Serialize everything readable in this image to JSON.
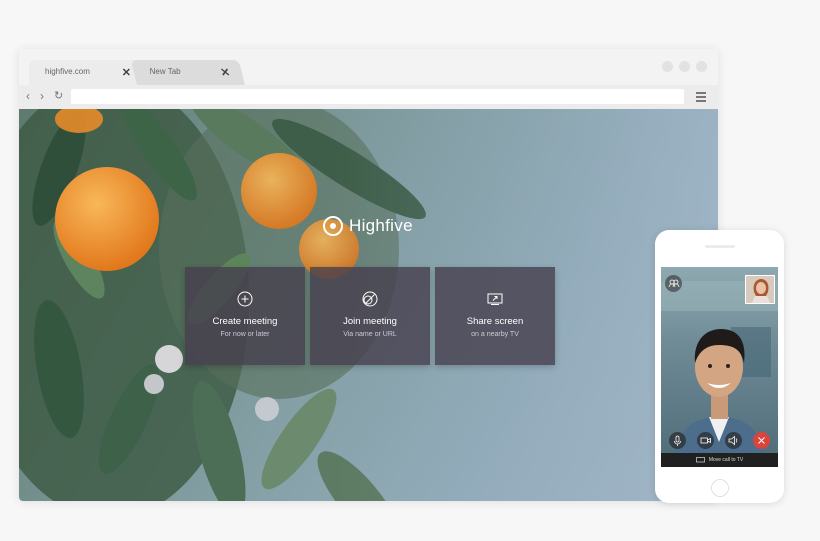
{
  "browser": {
    "tabs": [
      {
        "label": "highfive.com",
        "close": "✕"
      },
      {
        "label": "New Tab",
        "close": "✕"
      }
    ],
    "nav": {
      "back": "‹",
      "forward": "›",
      "reload": "↻"
    }
  },
  "app": {
    "logo_text": "Highfive",
    "cards": [
      {
        "title": "Create meeting",
        "subtitle": "For now or later",
        "icon": "plus-circle-icon"
      },
      {
        "title": "Join meeting",
        "subtitle": "Via name or URL",
        "icon": "join-circle-icon"
      },
      {
        "title": "Share screen",
        "subtitle": "on a nearby TV",
        "icon": "screen-share-icon"
      }
    ]
  },
  "phone": {
    "tv_bar_label": "Move call to TV",
    "controls": [
      "mic-icon",
      "camera-icon",
      "speaker-icon",
      "end-call-icon"
    ]
  },
  "colors": {
    "card_bg": "#463e4e",
    "end_call": "#d9443d",
    "page_bg": "#f7f7f7"
  }
}
